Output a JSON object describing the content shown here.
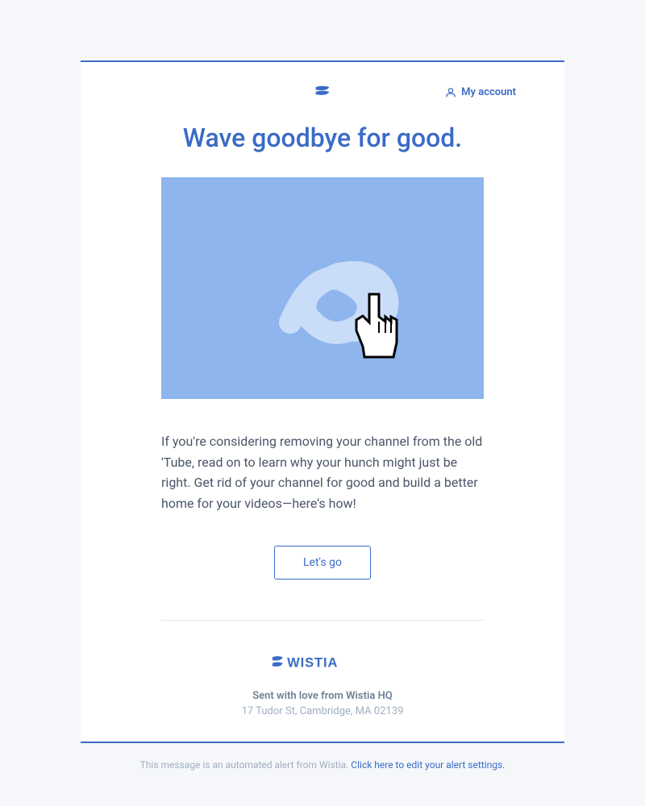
{
  "header": {
    "account_link": "My account"
  },
  "title": "Wave goodbye for good.",
  "body_text": "If you're considering removing your channel from the old 'Tube, read on to learn why your hunch might just be right. Get rid of your channel for good and build a better home for your videos—here's how!",
  "cta_label": "Let's go",
  "footer": {
    "brand": "WISTIA",
    "sent_text": "Sent with love from Wistia HQ",
    "address": "17 Tudor St, Cambridge, MA 02139"
  },
  "notice": {
    "text": "This message is an automated alert from Wistia. ",
    "link_text": "Click here to edit your alert settings."
  },
  "colors": {
    "primary": "#3a6bc5",
    "hero_bg": "#8eb5ed"
  }
}
